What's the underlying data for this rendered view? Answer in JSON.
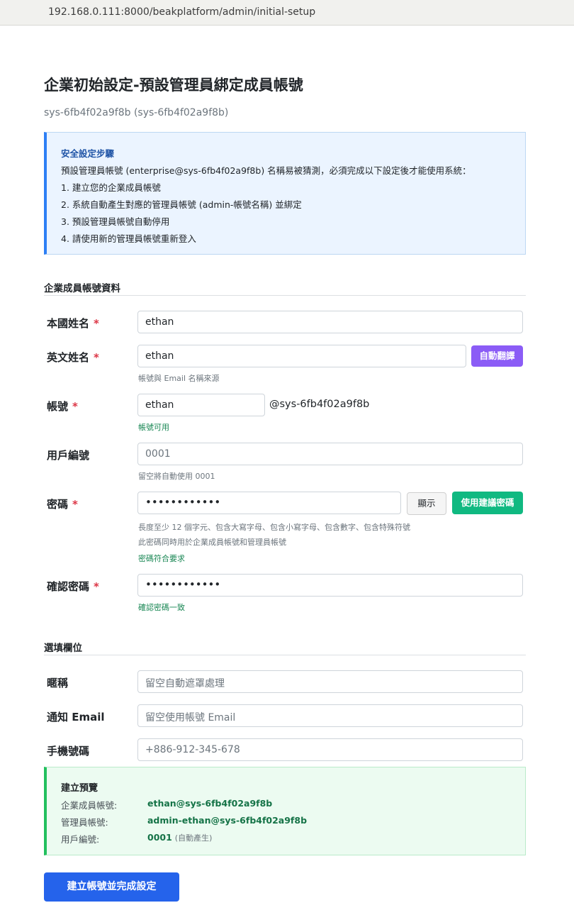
{
  "browser": {
    "url": "192.168.0.111:8000/beakplatform/admin/initial-setup"
  },
  "header": {
    "title": "企業初始設定-預設管理員綁定成員帳號",
    "subtitle": "sys-6fb4f02a9f8b (sys-6fb4f02a9f8b)"
  },
  "info": {
    "title": "安全設定步驟",
    "lines": [
      "預設管理員帳號 (enterprise@sys-6fb4f02a9f8b) 名稱易被猜測，必須完成以下設定後才能使用系統：",
      "1. 建立您的企業成員帳號",
      "2. 系統自動產生對應的管理員帳號 (admin-帳號名稱) 並綁定",
      "3. 預設管理員帳號自動停用",
      "4. 請使用新的管理員帳號重新登入"
    ]
  },
  "member_section": {
    "title": "企業成員帳號資料",
    "required_mark": "*",
    "native_name": {
      "label": "本國姓名",
      "value": "ethan"
    },
    "english_name": {
      "label": "英文姓名",
      "value": "ethan",
      "help": "帳號與 Email 名稱來源",
      "translate_button": "自動翻譯"
    },
    "account": {
      "label": "帳號",
      "value": "ethan",
      "suffix": "@sys-6fb4f02a9f8b",
      "status": "帳號可用"
    },
    "user_id": {
      "label": "用戶編號",
      "placeholder": "0001",
      "help": "留空將自動使用 0001"
    },
    "password": {
      "label": "密碼",
      "value": "••••••••••••",
      "show_button": "顯示",
      "suggest_button": "使用建議密碼",
      "help1": "長度至少 12 個字元、包含大寫字母、包含小寫字母、包含數字、包含特殊符號",
      "help2": "此密碼同時用於企業成員帳號和管理員帳號",
      "status": "密碼符合要求"
    },
    "confirm_password": {
      "label": "確認密碼",
      "value": "••••••••••••",
      "status": "確認密碼一致"
    }
  },
  "optional_section": {
    "title": "選填欄位",
    "nickname": {
      "label": "暱稱",
      "placeholder": "留空自動遮罩處理"
    },
    "notify_email": {
      "label": "通知 Email",
      "placeholder": "留空使用帳號 Email"
    },
    "mobile": {
      "label": "手機號碼",
      "placeholder": "+886-912-345-678"
    }
  },
  "preview": {
    "title": "建立預覽",
    "member_label": "企業成員帳號:",
    "member_value": "ethan@sys-6fb4f02a9f8b",
    "admin_label": "管理員帳號:",
    "admin_value": "admin-ethan@sys-6fb4f02a9f8b",
    "userid_label": "用戶編號:",
    "userid_value": "0001",
    "userid_note": "(自動產生)"
  },
  "submit_label": "建立帳號並完成設定",
  "colors": {
    "primary": "#2563eb",
    "purple": "#8b5cf6",
    "green": "#10b981",
    "required": "#dc3545",
    "success_text": "#198754"
  }
}
